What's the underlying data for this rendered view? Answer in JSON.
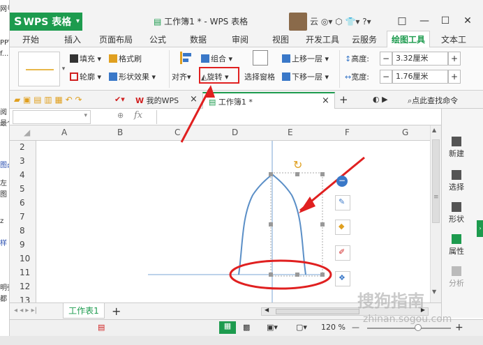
{
  "window": {
    "app_name": "WPS 表格",
    "doc_title": "工作簿1 * - WPS 表格",
    "user_name": "云",
    "title_icons": "◎▾ ⬡ 👕▾ ?▾",
    "win_controls": [
      "□",
      "—",
      "☐",
      "✕"
    ]
  },
  "left_strip": [
    "网号",
    "PPT",
    "f...",
    "阅",
    "最个",
    "图凸",
    "左",
    "图",
    "z",
    "样",
    "明强",
    "都"
  ],
  "ribbon_tabs": [
    "开始",
    "插入",
    "页面布局",
    "公式",
    "数据",
    "审阅",
    "视图",
    "开发工具",
    "云服务",
    "绘图工具",
    "文本工"
  ],
  "active_tab": "绘图工具",
  "ribbon": {
    "fill": "填充",
    "format_brush": "格式刷",
    "outline": "轮廓",
    "shape_effect": "形状效果",
    "align": "对齐",
    "rotate": "旋转",
    "group": "组合",
    "select_pane": "选择窗格",
    "bring_forward": "上移一层",
    "send_backward": "下移一层",
    "height_label": "高度:",
    "height_value": "3.32厘米",
    "width_label": "宽度:",
    "width_value": "1.76厘米",
    "minus": "−",
    "plus": "+"
  },
  "doc_tabs": {
    "my_wps": "我的WPS",
    "workbook": "工作簿1 *",
    "search": "点此查找命令",
    "close": "×",
    "add": "+"
  },
  "formula_bar": {
    "fx": "fx"
  },
  "columns": [
    "A",
    "B",
    "C",
    "D",
    "E",
    "F",
    "G"
  ],
  "rows": [
    "2",
    "3",
    "4",
    "5",
    "6",
    "7",
    "8",
    "9",
    "10",
    "11",
    "12",
    "13"
  ],
  "right_panel": [
    "新建",
    "选择",
    "形状",
    "属性",
    "分析"
  ],
  "sheet_tab": "工作表1",
  "sheet_nav": "◂ ◂ ▸ ▸|",
  "status": {
    "zoom": "120 %",
    "minus": "—",
    "plus": "+"
  },
  "watermark": {
    "brand": "搜狗指南",
    "url": "zhinan.sogou.com"
  },
  "colors": {
    "accent": "#1d9b4e",
    "annotation": "#e02020",
    "shape_outline": "#5b8fc7"
  }
}
